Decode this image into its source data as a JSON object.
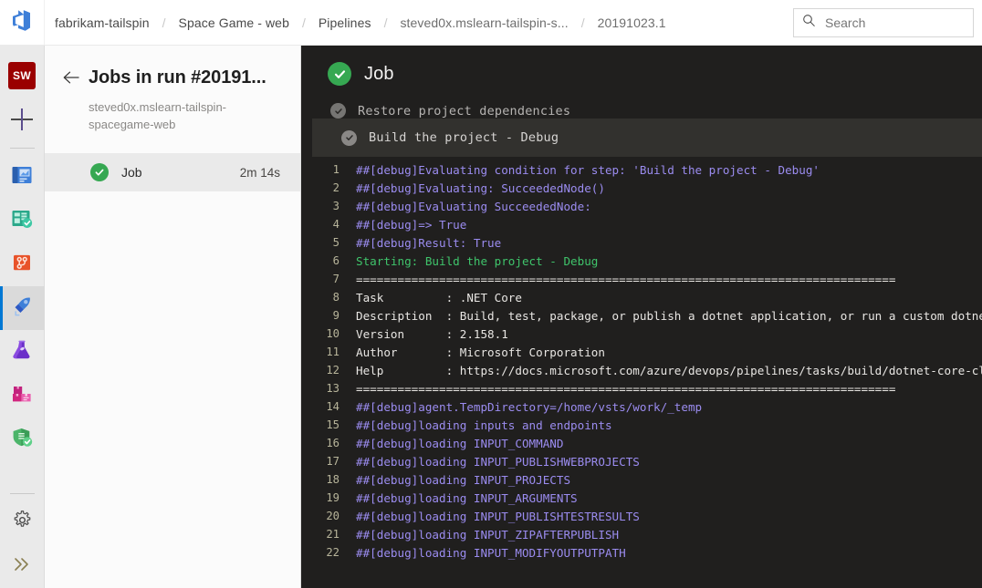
{
  "topbar": {
    "logo_icon": "azure-devops-logo",
    "breadcrumb": [
      {
        "label": "fabrikam-tailspin"
      },
      {
        "label": "Space Game - web"
      },
      {
        "label": "Pipelines"
      },
      {
        "label": "steved0x.mslearn-tailspin-s..."
      },
      {
        "label": "20191023.1"
      }
    ],
    "separator": "/",
    "search": {
      "placeholder": "Search",
      "icon": "search-icon"
    }
  },
  "vnav": {
    "project_badge": "SW",
    "items": [
      {
        "name": "new-item",
        "icon": "plus-icon"
      },
      {
        "name": "overview",
        "icon": "boards-overview-icon"
      },
      {
        "name": "boards",
        "icon": "boards-icon"
      },
      {
        "name": "repos",
        "icon": "repos-icon"
      },
      {
        "name": "pipelines",
        "icon": "pipelines-rocket-icon",
        "active": true
      },
      {
        "name": "test-plans",
        "icon": "test-plans-flask-icon"
      },
      {
        "name": "artifacts",
        "icon": "artifacts-boxes-icon"
      },
      {
        "name": "security",
        "icon": "security-shield-icon"
      },
      {
        "name": "project-settings",
        "icon": "gear-icon"
      },
      {
        "name": "expand-nav",
        "icon": "chevron-double-right-icon"
      }
    ]
  },
  "jobs_panel": {
    "back_icon": "arrow-left-icon",
    "title": "Jobs in run #20191...",
    "subtitle": "steved0x.mslearn-tailspin-spacegame-web",
    "columns": [
      "status",
      "name",
      "duration"
    ],
    "rows": [
      {
        "status": "succeeded",
        "status_icon": "check-circle-icon",
        "name": "Job",
        "duration": "2m 14s",
        "selected": true
      }
    ]
  },
  "log_pane": {
    "header": {
      "title": "Job",
      "status_icon": "check-circle-icon",
      "status": "succeeded"
    },
    "steps": [
      {
        "label": "Restore project dependencies",
        "status_icon": "check-circle-icon",
        "clipped": true,
        "current": false
      },
      {
        "label": "Build the project - Debug",
        "status_icon": "check-circle-icon",
        "clipped": false,
        "current": true
      }
    ],
    "lines": [
      {
        "n": "1",
        "text": "##[debug]Evaluating condition for step: 'Build the project - Debug'",
        "cls": "c-debug"
      },
      {
        "n": "2",
        "text": "##[debug]Evaluating: SucceededNode()",
        "cls": "c-debug"
      },
      {
        "n": "3",
        "text": "##[debug]Evaluating SucceededNode:",
        "cls": "c-debug"
      },
      {
        "n": "4",
        "text": "##[debug]=> True",
        "cls": "c-debug"
      },
      {
        "n": "5",
        "text": "##[debug]Result: True",
        "cls": "c-debug"
      },
      {
        "n": "6",
        "text": "Starting: Build the project - Debug",
        "cls": "c-green"
      },
      {
        "n": "7",
        "text": "==============================================================================",
        "cls": "c-plain"
      },
      {
        "n": "8",
        "text": "Task         : .NET Core",
        "cls": "c-plain"
      },
      {
        "n": "9",
        "text": "Description  : Build, test, package, or publish a dotnet application, or run a custom dotnet command",
        "cls": "c-plain"
      },
      {
        "n": "10",
        "text": "Version      : 2.158.1",
        "cls": "c-plain"
      },
      {
        "n": "11",
        "text": "Author       : Microsoft Corporation",
        "cls": "c-plain"
      },
      {
        "n": "12",
        "text": "Help         : https://docs.microsoft.com/azure/devops/pipelines/tasks/build/dotnet-core-cli",
        "cls": "c-plain"
      },
      {
        "n": "13",
        "text": "==============================================================================",
        "cls": "c-plain"
      },
      {
        "n": "14",
        "text": "##[debug]agent.TempDirectory=/home/vsts/work/_temp",
        "cls": "c-debug"
      },
      {
        "n": "15",
        "text": "##[debug]loading inputs and endpoints",
        "cls": "c-debug"
      },
      {
        "n": "16",
        "text": "##[debug]loading INPUT_COMMAND",
        "cls": "c-debug"
      },
      {
        "n": "17",
        "text": "##[debug]loading INPUT_PUBLISHWEBPROJECTS",
        "cls": "c-debug"
      },
      {
        "n": "18",
        "text": "##[debug]loading INPUT_PROJECTS",
        "cls": "c-debug"
      },
      {
        "n": "19",
        "text": "##[debug]loading INPUT_ARGUMENTS",
        "cls": "c-debug"
      },
      {
        "n": "20",
        "text": "##[debug]loading INPUT_PUBLISHTESTRESULTS",
        "cls": "c-debug"
      },
      {
        "n": "21",
        "text": "##[debug]loading INPUT_ZIPAFTERPUBLISH",
        "cls": "c-debug"
      },
      {
        "n": "22",
        "text": "##[debug]loading INPUT_MODIFYOUTPUTPATH",
        "cls": "c-debug"
      }
    ]
  },
  "colors": {
    "accent": "#0078d4",
    "success": "#36a852",
    "log_background": "#201f1e",
    "log_step_highlight": "#32312e",
    "debug_text": "#9b8cf0",
    "green_text": "#3fc46b",
    "line_number": "#b7b49a",
    "project_badge": "#9a0000"
  }
}
